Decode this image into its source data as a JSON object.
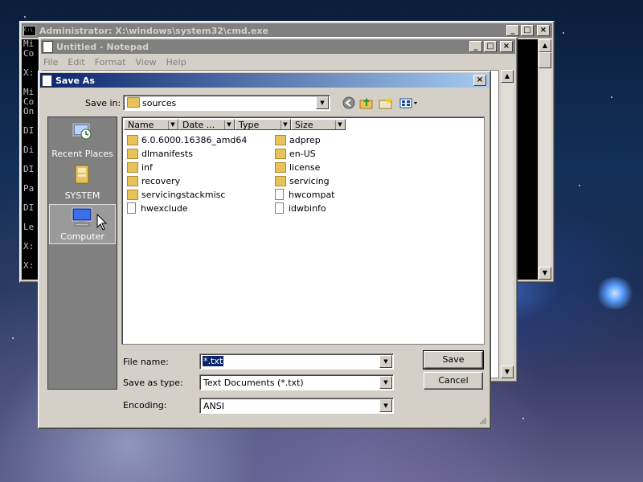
{
  "cmd_window": {
    "title": "Administrator: X:\\windows\\system32\\cmd.exe",
    "console_lines": [
      "Mi",
      "Co",
      "",
      "X:",
      "",
      "Mi",
      "Co",
      "On",
      "",
      "DI",
      "",
      "Di",
      "",
      "DI",
      "",
      "Pa",
      "",
      "DI",
      "",
      "Le",
      "X:",
      "",
      "X:"
    ]
  },
  "notepad_window": {
    "title": "Untitled - Notepad",
    "menu": [
      "File",
      "Edit",
      "Format",
      "View",
      "Help"
    ]
  },
  "save_dialog": {
    "title": "Save As",
    "save_in_label": "Save in:",
    "save_in_value": "sources",
    "places": [
      {
        "label": "Recent Places",
        "icon": "recent-places-icon"
      },
      {
        "label": "SYSTEM",
        "icon": "user-folder-icon"
      },
      {
        "label": "Computer",
        "icon": "computer-icon",
        "selected": true
      }
    ],
    "columns": [
      "Name",
      "Date ...",
      "Type",
      "Size"
    ],
    "files_col1": [
      {
        "name": "6.0.6000.16386_amd64",
        "kind": "folder"
      },
      {
        "name": "dlmanifests",
        "kind": "folder"
      },
      {
        "name": "inf",
        "kind": "folder"
      },
      {
        "name": "recovery",
        "kind": "folder"
      },
      {
        "name": "servicingstackmisc",
        "kind": "folder"
      },
      {
        "name": "hwexclude",
        "kind": "file"
      }
    ],
    "files_col2": [
      {
        "name": "adprep",
        "kind": "folder"
      },
      {
        "name": "en-US",
        "kind": "folder"
      },
      {
        "name": "license",
        "kind": "folder"
      },
      {
        "name": "servicing",
        "kind": "folder"
      },
      {
        "name": "hwcompat",
        "kind": "file"
      },
      {
        "name": "idwbinfo",
        "kind": "file"
      }
    ],
    "file_name_label": "File name:",
    "file_name_value": "*.txt",
    "save_type_label": "Save as type:",
    "save_type_value": "Text Documents (*.txt)",
    "encoding_label": "Encoding:",
    "encoding_value": "ANSI",
    "save_button": "Save",
    "cancel_button": "Cancel"
  }
}
